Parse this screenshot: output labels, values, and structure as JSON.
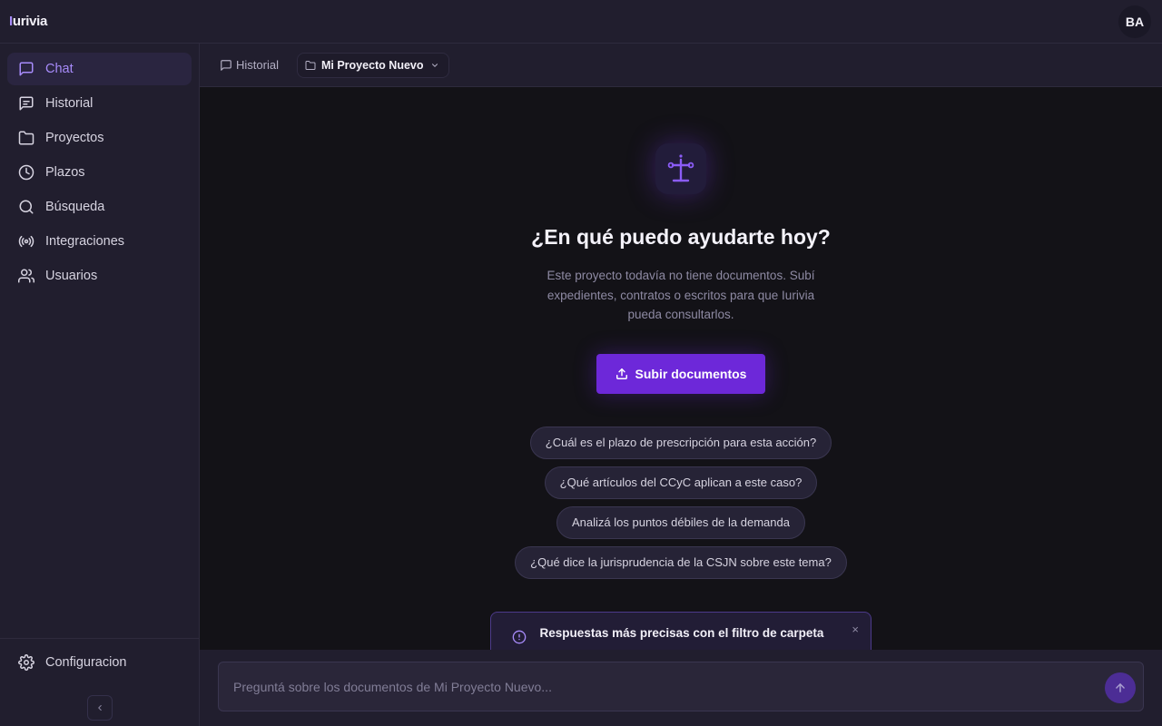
{
  "app": {
    "logo_first": "I",
    "logo_rest": "urivia",
    "avatar_initials": "BA"
  },
  "sidebar": {
    "items": [
      {
        "label": "Chat",
        "icon": "message-square-icon",
        "active": true
      },
      {
        "label": "Historial",
        "icon": "message-list-icon"
      },
      {
        "label": "Proyectos",
        "icon": "folder-icon"
      },
      {
        "label": "Plazos",
        "icon": "clock-icon"
      },
      {
        "label": "Búsqueda",
        "icon": "search-icon"
      },
      {
        "label": "Integraciones",
        "icon": "broadcast-icon"
      },
      {
        "label": "Usuarios",
        "icon": "users-icon"
      }
    ],
    "settings_label": "Configuracion",
    "collapse_icon": "chevron-left-icon"
  },
  "header": {
    "history_label": "Historial",
    "project_name": "Mi Proyecto Nuevo"
  },
  "hero": {
    "icon": "scales-icon",
    "title": "¿En qué puedo ayudarte hoy?",
    "subtitle": "Este proyecto todavía no tiene documentos. Subí expedientes, contratos o escritos para que Iurivia pueda consultarlos.",
    "upload_label": "Subir documentos"
  },
  "suggestions": [
    "¿Cuál es el plazo de prescripción para esta acción?",
    "¿Qué artículos del CCyC aplican a este caso?",
    "Analizá los puntos débiles de la demanda",
    "¿Qué dice la jurisprudencia de la CSJN sobre este tema?"
  ],
  "notice": {
    "title": "Respuestas más precisas con el filtro de carpeta",
    "close": "×"
  },
  "composer": {
    "placeholder": "Preguntá sobre los documentos de Mi Proyecto Nuevo..."
  },
  "colors": {
    "accent": "#a78bfa",
    "primary_button": "#6d28d9",
    "sidebar_bg": "#211e2e",
    "main_bg": "#131217"
  }
}
